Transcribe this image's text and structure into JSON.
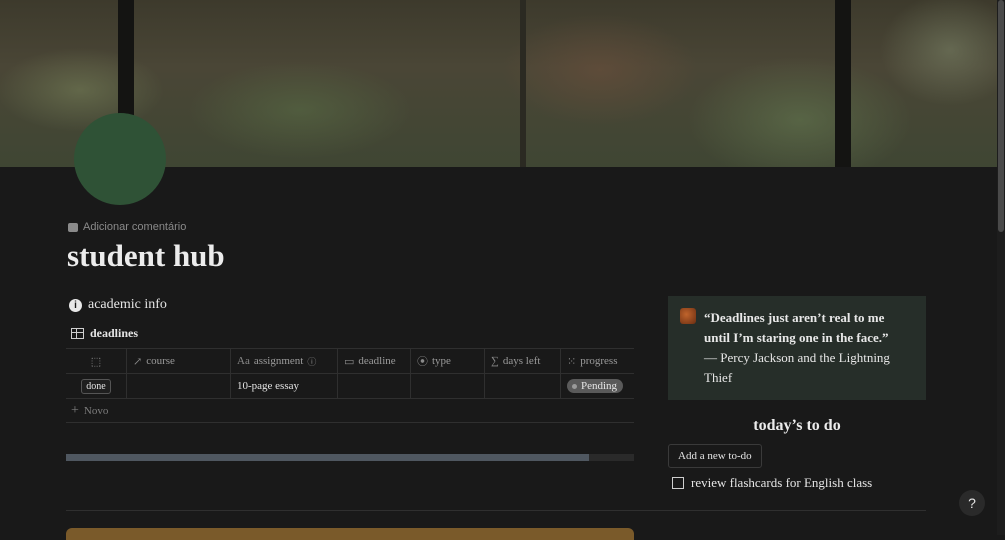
{
  "page": {
    "comment_label": "Adicionar comentário",
    "title": "student hub"
  },
  "academic": {
    "heading": "academic info",
    "database_title": "deadlines",
    "columns": [
      "course",
      "assignment",
      "deadline",
      "type",
      "days left",
      "progress"
    ],
    "rows": [
      {
        "done_label": "done",
        "course": "",
        "assignment": "10-page essay",
        "deadline": "",
        "type": "",
        "days_left": "",
        "progress": "Pending"
      }
    ],
    "new_label": "Novo",
    "progress_fraction": 0.92
  },
  "quote": {
    "bold": "“Deadlines just aren’t real to me until I’m staring one in the face.”",
    "author": "— Percy Jackson and the Lightning Thief"
  },
  "todo": {
    "heading": "today’s to do",
    "add_button": "Add a new to-do",
    "items": [
      {
        "label": "review flashcards for English class",
        "checked": false
      }
    ]
  },
  "help_label": "?",
  "colors": {
    "background": "#191919",
    "avatar": "#2f5236",
    "quote_bg": "#262e29",
    "pill": "#5a5a5a"
  }
}
